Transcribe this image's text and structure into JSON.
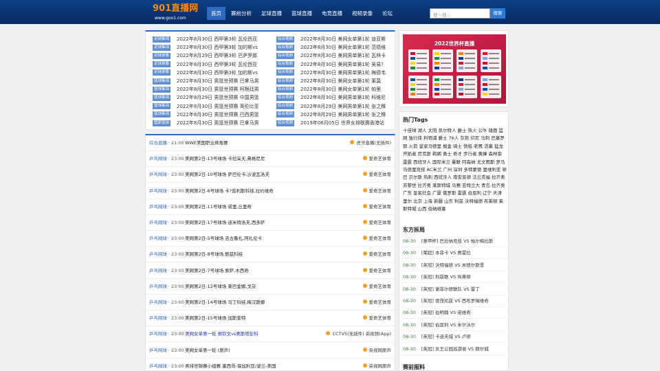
{
  "site": {
    "logo": "901直播网",
    "logo_sub": "www.goo1.com"
  },
  "nav": [
    "首页",
    "赛前分析",
    "足球直播",
    "篮球直播",
    "电竞直播",
    "视频录像",
    "论坛"
  ],
  "search": {
    "placeholder": "搜一搜...",
    "button": "搜索"
  },
  "news_left": [
    {
      "tag": "足球集锦",
      "text": "2022年8月30日 西甲第3轮 瓦伦西亚"
    },
    {
      "tag": "足球集锦",
      "text": "2022年8月30日 西甲第3轮 加的斯vs"
    },
    {
      "tag": "足球录像",
      "text": "2022年8月29日 西甲第3轮 巴萨罗那"
    },
    {
      "tag": "足球录像",
      "text": "2022年8月30日 西甲第3轮 瓦伦西亚"
    },
    {
      "tag": "足球录像",
      "text": "2022年8月30日 西甲第3轮 加的斯vs"
    },
    {
      "tag": "篮球集锦",
      "text": "2022年8月30日 男篮世预赛 巴拿马男"
    },
    {
      "tag": "篮球集锦",
      "text": "2022年8月30日 男篮世预赛 阿根廷男"
    },
    {
      "tag": "篮球集锦",
      "text": "2022年8月29日 男篮世预赛 中国男篮"
    },
    {
      "tag": "篮球集锦",
      "text": "2022年8月30日 男篮世预赛 哥伦比亚"
    },
    {
      "tag": "篮球集锦",
      "text": "2022年8月30日 男篮世预赛 巴西男篮"
    },
    {
      "tag": "国家篮球",
      "text": "2022年8月30日 男篮世预赛 巴拿马男"
    }
  ],
  "news_right": [
    {
      "tag": "综合视频",
      "text": "2022年8月30日 美网女单第1轮 迪亚斯"
    },
    {
      "tag": "综合视频",
      "text": "2022年8月30日 美网女单第1轮 范德维"
    },
    {
      "tag": "综合视频",
      "text": "2022年8月30日 美网男单第1轮 瓦林卡"
    },
    {
      "tag": "综合视频",
      "text": "2022年8月30日 美网男单第1轮 吴易?"
    },
    {
      "tag": "综合视频",
      "text": "2022年8月30日 美网男单第1轮 梅德韦"
    },
    {
      "tag": "综合视频",
      "text": "2022年8月30日 美网女单第1轮 莱莫"
    },
    {
      "tag": "综合视频",
      "text": "2022年8月30日 美网女单第1轮 帕里"
    },
    {
      "tag": "综合视频",
      "text": "2022年8月30日 美网男单第1轮 科维尼"
    },
    {
      "tag": "综合视频",
      "text": "2022年8月29日 美网男单第1轮 张之臻"
    },
    {
      "tag": "综合视频",
      "text": "2022年8月29日 美网男单第1轮 张之臻"
    },
    {
      "tag": "综合视频",
      "text": "2019年06月05日 世界女排联赛香港站"
    }
  ],
  "schedule": [
    {
      "cat": "综合直播",
      "time": "21:00",
      "title": "WWE美国职业摔角赛",
      "channel": "虎牙直播(无插件)",
      "hl": false
    },
    {
      "cat": "乒乓网球",
      "time": "23:00",
      "title": "美网第2日-13号球场 卡拉采夫,弗格尼尼",
      "channel": "爱奇艺体育",
      "hl": false
    },
    {
      "cat": "乒乓网球",
      "time": "23:00",
      "title": "美网第2日-10号球场 萨巴伦卡,沙波瓦洛夫",
      "channel": "爱奇艺体育",
      "hl": false
    },
    {
      "cat": "乒乓网球",
      "time": "23:00",
      "title": "美网第2日-6号球场 卡?普利斯科娃,拉约维奇",
      "channel": "爱奇艺体育",
      "hl": false
    },
    {
      "cat": "乒乓网球",
      "time": "23:00",
      "title": "美网第2日-11号球场 诺里,丘里奇",
      "channel": "爱奇艺体育",
      "hl": false
    },
    {
      "cat": "乒乓网球",
      "time": "23:00",
      "title": "美网第2日-17号球场 迪米特洛夫,西多萨",
      "channel": "爱奇艺体育",
      "hl": false
    },
    {
      "cat": "乒乓网球",
      "time": "23:00",
      "title": "美网第2日-5号球场 吉古鲁扎,阿扎伦卡",
      "channel": "爱奇艺体育",
      "hl": false
    },
    {
      "cat": "乒乓网球",
      "time": "23:00",
      "title": "美网第2日-8号球场 鲍兹科娃",
      "channel": "爱奇艺体育",
      "hl": false
    },
    {
      "cat": "乒乓网球",
      "time": "23:00",
      "title": "美网第2日-7号球场 索萨,木西奇",
      "channel": "爱奇艺体育",
      "hl": false
    },
    {
      "cat": "乒乓网球",
      "time": "23:00",
      "title": "美网第2日-12号球场 莱巴金娜,戈芬",
      "channel": "爱奇艺体育",
      "hl": false
    },
    {
      "cat": "乒乓网球",
      "time": "23:00",
      "title": "美网第2日-14号球场 马丁科娃,梅汉斯娜",
      "channel": "爱奇艺体育",
      "hl": false
    },
    {
      "cat": "乒乓网球",
      "time": "23:00",
      "title": "美网第2日-15号球场 加斯奎特",
      "channel": "爱奇艺体育",
      "hl": false
    },
    {
      "cat": "乒乓网球",
      "time": "23:00",
      "title": "美网女单第一轮 郑钦文vs奥斯塔彭科",
      "channel": "CCTV5(无插件) 央视频(App)",
      "hl": true
    },
    {
      "cat": "乒乓网球",
      "time": "23:00",
      "title": "美网女单第一轮 (原声)",
      "channel": "央视网原声",
      "hl": false
    },
    {
      "cat": "乒乓网球",
      "time": "23:00",
      "title": "男排世锦赛小组赛 墨西哥-保加利亚/波兰-美国",
      "channel": "央视网原声",
      "hl": false
    }
  ],
  "poster": {
    "title": "2022世界杯直播"
  },
  "tags_title": "热门Tags",
  "tags": [
    "十佳球",
    "湖人",
    "太阳",
    "凯尔特人",
    "爵士",
    "热火",
    "公牛",
    "雄鹿",
    "篮网",
    "独行侠",
    "利物浦",
    "爵士",
    "76人",
    "灰熊",
    "印尼",
    "马刺",
    "巴塞罗那",
    "火箭",
    "皇家马德里",
    "掘金",
    "骑士",
    "快船",
    "老鹰",
    "活塞",
    "猛龙",
    "开拓者",
    "尼克斯",
    "鹈鹕",
    "勇士",
    "奇才",
    "步行者",
    "黄蜂",
    "森林狼",
    "雷霆",
    "西班牙人",
    "国际米兰",
    "曼联",
    "阿森纳",
    "尤文图斯",
    "罗马",
    "马德里竞技",
    "AC米兰",
    "广州",
    "深圳",
    "多特蒙德",
    "里维利亚",
    "顿巴",
    "贝尔斯",
    "热刺",
    "西班牙人",
    "南安普顿",
    "法兰克福",
    "拉齐奥",
    "苏黎世",
    "拉齐奥",
    "莱斯特城",
    "马赛",
    "亚特兰大",
    "青岛",
    "拉齐奥",
    "广东",
    "皇家社会",
    "广厦",
    "俄罗斯",
    "雷霆",
    "伯恩利",
    "辽宁",
    "天津",
    "里尔",
    "北京",
    "上海",
    "新疆",
    "山东",
    "利兹",
    "沃特福德",
    "布莱顿",
    "莱斯特城",
    "山西",
    "伯纳维塞"
  ],
  "east_title": "东方拆局",
  "east": [
    {
      "time": "08-30",
      "text": "[意甲杯] 巴拉纳竞技 VS 帕尔梅拉斯"
    },
    {
      "time": "08-30",
      "text": "[葡超] 本菲卡 VS 赛雷拉"
    },
    {
      "time": "08-30",
      "text": "[英冠] 沃特福德 VS 米德尔斯堡"
    },
    {
      "time": "08-30",
      "text": "[英冠] 利兹联 VS 埃弗顿"
    },
    {
      "time": "08-30",
      "text": "[英冠] 谢菲尔德联队 VS 雷丁"
    },
    {
      "time": "08-30",
      "text": "[英冠] 德茂凯兹 VS 西布罗姆维奇"
    },
    {
      "time": "08-30",
      "text": "[英冠] 伯明翰 VS 诺维奇"
    },
    {
      "time": "08-30",
      "text": "[英冠] 伯恩利 VS 米尔沃尔"
    },
    {
      "time": "08-30",
      "text": "[英冠] 卡迪夫城 VS 卢顿"
    },
    {
      "time": "08-30",
      "text": "[英冠] 女王公园巡游者 VS 赫尔城"
    }
  ],
  "pre_title": "赛前报料"
}
